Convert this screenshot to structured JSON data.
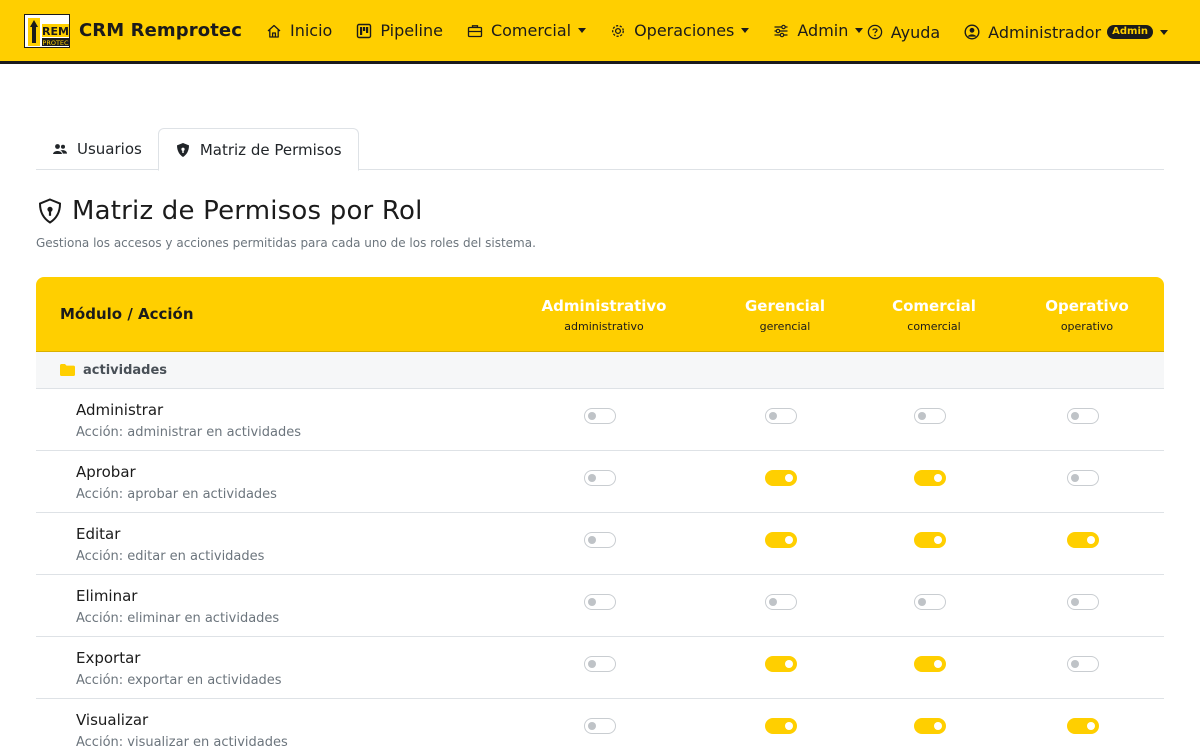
{
  "navbar": {
    "brand": "CRM Remprotec",
    "logo_text_top": "REM",
    "logo_text_bottom": "PROTEC",
    "items": [
      {
        "label": "Inicio",
        "icon": "home-icon"
      },
      {
        "label": "Pipeline",
        "icon": "kanban-icon"
      },
      {
        "label": "Comercial",
        "icon": "briefcase-icon",
        "dropdown": true
      },
      {
        "label": "Operaciones",
        "icon": "gear-icon",
        "dropdown": true
      },
      {
        "label": "Admin",
        "icon": "sliders-icon",
        "dropdown": true
      }
    ],
    "help": "Ayuda",
    "user": "Administrador",
    "user_badge": "Admin"
  },
  "tabs": [
    {
      "label": "Usuarios",
      "icon": "users-icon",
      "active": false
    },
    {
      "label": "Matriz de Permisos",
      "icon": "shield-icon",
      "active": true
    }
  ],
  "page": {
    "title": "Matriz de Permisos por Rol",
    "subtitle": "Gestiona los accesos y acciones permitidas para cada uno de los roles del sistema."
  },
  "matrix": {
    "module_header": "Módulo / Acción",
    "roles": [
      {
        "name": "Administrativo",
        "key": "administrativo"
      },
      {
        "name": "Gerencial",
        "key": "gerencial"
      },
      {
        "name": "Comercial",
        "key": "comercial"
      },
      {
        "name": "Operativo",
        "key": "operativo"
      }
    ],
    "group": "actividades",
    "rows": [
      {
        "label": "Administrar",
        "desc": "Acción: administrar en actividades",
        "perms": [
          false,
          false,
          false,
          false
        ]
      },
      {
        "label": "Aprobar",
        "desc": "Acción: aprobar en actividades",
        "perms": [
          false,
          true,
          true,
          false
        ]
      },
      {
        "label": "Editar",
        "desc": "Acción: editar en actividades",
        "perms": [
          false,
          true,
          true,
          true
        ]
      },
      {
        "label": "Eliminar",
        "desc": "Acción: eliminar en actividades",
        "perms": [
          false,
          false,
          false,
          false
        ]
      },
      {
        "label": "Exportar",
        "desc": "Acción: exportar en actividades",
        "perms": [
          false,
          true,
          true,
          false
        ]
      },
      {
        "label": "Visualizar",
        "desc": "Acción: visualizar en actividades",
        "perms": [
          false,
          true,
          true,
          true
        ]
      }
    ]
  },
  "colors": {
    "accent": "#ffcf00",
    "dark": "#1b1b1b",
    "muted": "#6c757d",
    "border": "#dee2e6"
  }
}
